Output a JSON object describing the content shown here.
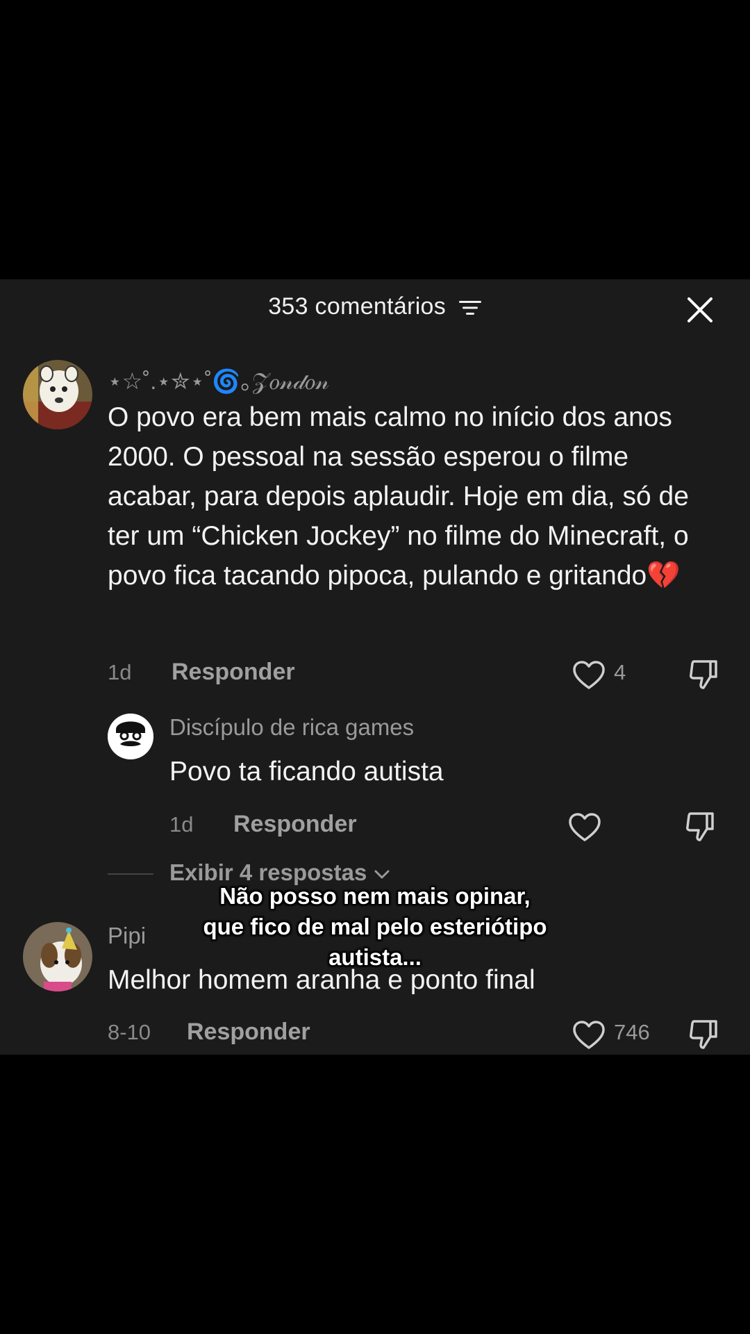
{
  "header": {
    "title": "353 comentários"
  },
  "comments": [
    {
      "username": "⋆☆˚.⋆✮⋆˚🌀｡𝒵𝑜𝓃𝒹𝑜𝓃",
      "text": "O povo era bem mais calmo no início dos anos 2000. O pessoal na sessão esperou o filme acabar, para depois aplaudir. Hoje em dia, só de ter um “Chicken Jockey” no filme do Minecraft, o povo fica tacando pipoca, pulando e gritando💔",
      "time": "1d",
      "reply_label": "Responder",
      "likes": "4"
    },
    {
      "username": "Discípulo de rica games",
      "text": "Povo ta ficando autista",
      "time": "1d",
      "reply_label": "Responder",
      "likes": ""
    },
    {
      "username": "Pipi",
      "text": "Melhor homem aranha e ponto final",
      "time": "8-10",
      "reply_label": "Responder",
      "likes": "746"
    }
  ],
  "view_replies": "Exibir 4 respostas",
  "caption": {
    "line1": "Não posso nem mais opinar,",
    "line2": "que fico de mal pelo esteriótipo",
    "line3": "autista..."
  },
  "icons": [
    "sort-icon",
    "close-icon",
    "heart-icon",
    "dislike-icon",
    "chevron-down-icon"
  ],
  "colors": {
    "panel": "#1b1b1b",
    "text": "#f3f3f3",
    "muted": "#9a9a9a"
  }
}
